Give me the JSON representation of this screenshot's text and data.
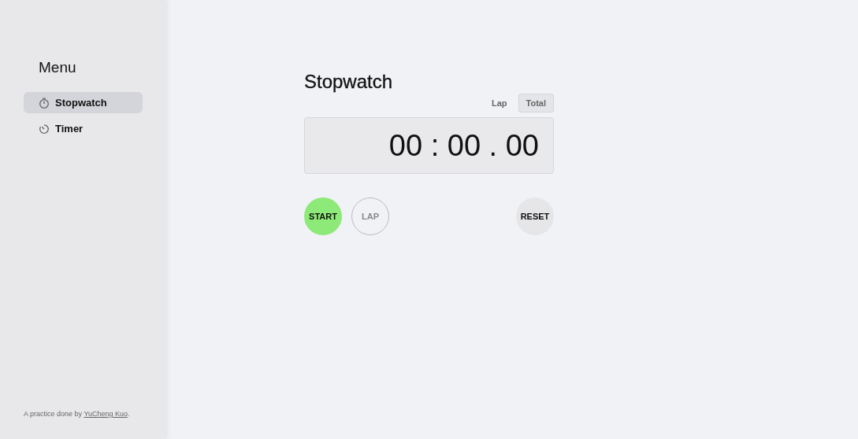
{
  "sidebar": {
    "title": "Menu",
    "items": [
      {
        "label": "Stopwatch",
        "kind": "stopwatch",
        "selected": true
      },
      {
        "label": "Timer",
        "kind": "timer",
        "selected": false
      }
    ],
    "footer": {
      "text": "A practice done by ",
      "link": "YuCheng Kuo",
      "after": "."
    }
  },
  "main": {
    "title": "Stopwatch",
    "modes": [
      {
        "label": "Lap",
        "selected": false
      },
      {
        "label": "Total",
        "selected": true
      }
    ],
    "display": "00 : 00 . 00",
    "buttons": [
      {
        "label": "START",
        "kind": "start",
        "disabled": false
      },
      {
        "label": "LAP",
        "kind": "lap",
        "disabled": true
      },
      {
        "label": "RESET",
        "kind": "reset",
        "disabled": false
      }
    ]
  }
}
